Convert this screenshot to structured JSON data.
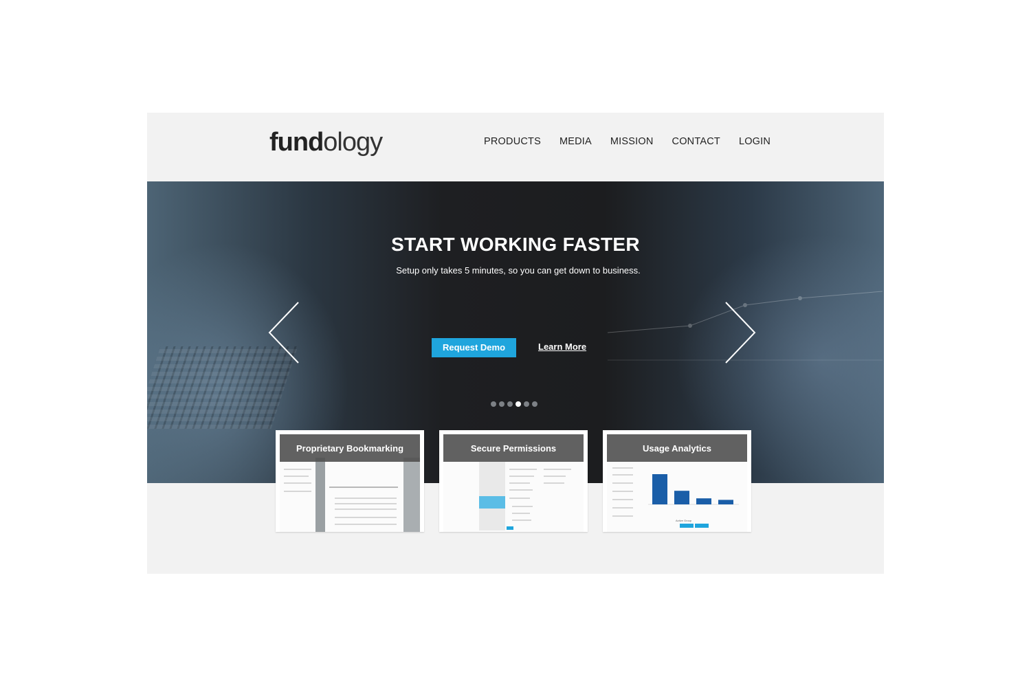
{
  "header": {
    "logo_bold": "fund",
    "logo_light": "ology",
    "nav": [
      "PRODUCTS",
      "MEDIA",
      "MISSION",
      "CONTACT",
      "LOGIN"
    ]
  },
  "hero": {
    "title": "START WORKING FASTER",
    "subtitle": "Setup only takes 5 minutes, so you can get down to business.",
    "primary_button": "Request Demo",
    "secondary_link": "Learn More",
    "slides_total": 6,
    "active_slide": 4
  },
  "features": [
    {
      "title": "Proprietary Bookmarking",
      "icon": "bookmark-screenshot"
    },
    {
      "title": "Secure Permissions",
      "icon": "permissions-screenshot"
    },
    {
      "title": "Usage Analytics",
      "icon": "analytics-screenshot"
    }
  ],
  "analytics_preview": {
    "type": "bar",
    "xlabel": "Active Group",
    "values": [
      100,
      45,
      20,
      15
    ]
  },
  "colors": {
    "accent": "#1fa5dd",
    "header_bg": "#f2f2f2",
    "hero_bg": "#1e1f22"
  }
}
